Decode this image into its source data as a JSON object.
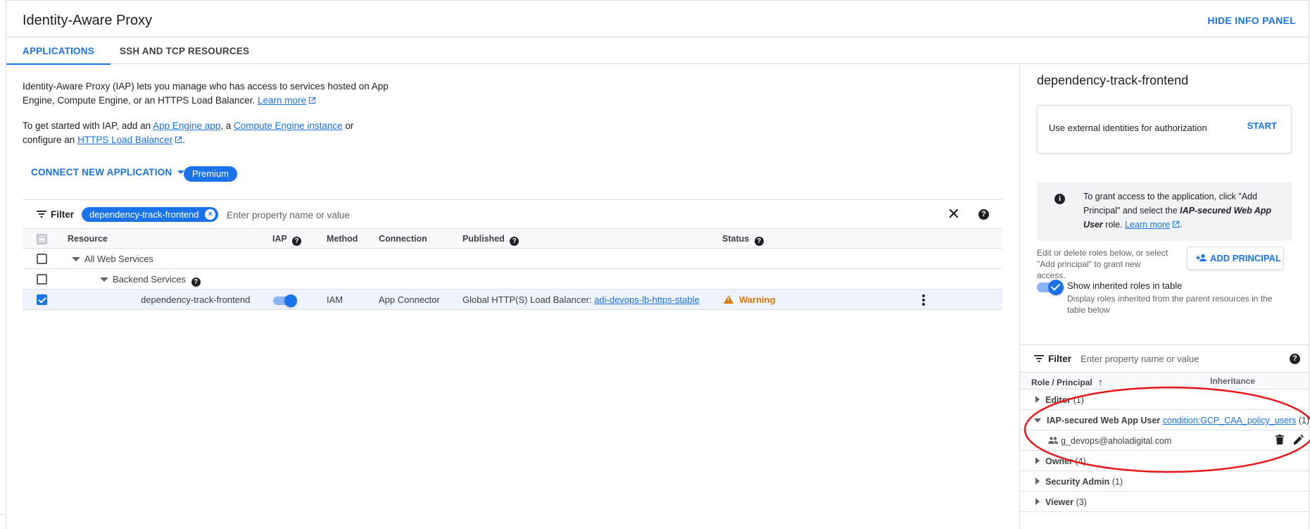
{
  "header": {
    "title": "Identity-Aware Proxy",
    "hide_panel": "HIDE INFO PANEL"
  },
  "tabs": [
    {
      "label": "APPLICATIONS",
      "active": true
    },
    {
      "label": "SSH AND TCP RESOURCES",
      "active": false
    }
  ],
  "intro": {
    "p1_text": "Identity-Aware Proxy (IAP) lets you manage who has access to services hosted on App Engine, Compute Engine, or an HTTPS Load Balancer.",
    "p1_link": "Learn more",
    "p2_prefix": "To get started with IAP, add an",
    "p2_link1": "App Engine app",
    "p2_mid1": ", a",
    "p2_link2": "Compute Engine instance",
    "p2_mid2": "or configure an",
    "p2_link3": "HTTPS Load Balancer",
    "p2_suffix": "."
  },
  "connect_button": "CONNECT NEW APPLICATION",
  "premium_badge": "Premium",
  "filter": {
    "label": "Filter",
    "chip": "dependency-track-frontend",
    "placeholder": "Enter property name or value"
  },
  "table": {
    "columns": {
      "resource": "Resource",
      "iap": "IAP",
      "method": "Method",
      "connection": "Connection",
      "published": "Published",
      "status": "Status"
    },
    "rows": [
      {
        "resource": "All Web Services"
      },
      {
        "resource": "Backend Services"
      },
      {
        "resource": "dependency-track-frontend",
        "iap_enabled": true,
        "method": "IAM",
        "connection": "App Connector",
        "published_prefix": "Global HTTP(S) Load Balancer:",
        "published_link": "adi-devops-lb-https-stable",
        "status": "Warning"
      }
    ]
  },
  "side_panel": {
    "title": "dependency-track-frontend",
    "ext_card_text": "Use external identities for authorization",
    "start": "START",
    "info_prefix": "To grant access to the application, click \"Add Principal\" and select the",
    "info_role": "IAP-secured Web App User",
    "info_suffix": "role.",
    "info_link": "Learn more",
    "edit_desc": "Edit or delete roles below, or select \"Add principal\" to grant new access.",
    "add_principal": "ADD PRINCIPAL",
    "inherited_title": "Show inherited roles in table",
    "inherited_desc": "Display roles inherited from the parent resources in the table below",
    "filter_label": "Filter",
    "filter_placeholder": "Enter property name or value",
    "col_role": "Role / Principal",
    "col_inheritance": "Inheritance",
    "roles": [
      {
        "name": "Editor",
        "count": "(1)"
      },
      {
        "name": "IAP-secured Web App User",
        "condition": "condition:GCP_CAA_policy_users",
        "count": "(1)"
      },
      {
        "name": "Owner",
        "count": "(4)"
      },
      {
        "name": "Security Admin",
        "count": "(1)"
      },
      {
        "name": "Viewer",
        "count": "(3)"
      }
    ],
    "member": "g_devops@aholadigital.com"
  },
  "colors": {
    "accent": "#1a73e8",
    "warning": "#e37400",
    "annotation": "#e8171c"
  }
}
